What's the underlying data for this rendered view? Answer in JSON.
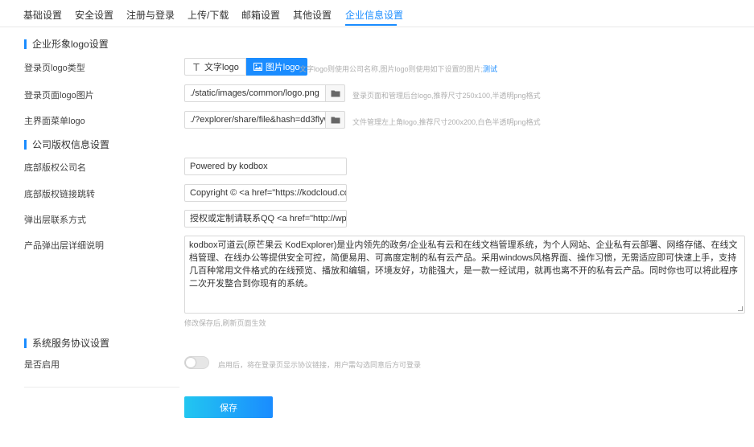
{
  "tabs": [
    {
      "label": "基础设置"
    },
    {
      "label": "安全设置"
    },
    {
      "label": "注册与登录"
    },
    {
      "label": "上传/下载"
    },
    {
      "label": "邮箱设置"
    },
    {
      "label": "其他设置"
    },
    {
      "label": "企业信息设置",
      "active": true
    }
  ],
  "sections": {
    "logo": {
      "title": "企业形象logo设置",
      "login_logo_type": {
        "label": "登录页logo类型",
        "options": [
          "文字logo",
          "图片logo"
        ],
        "selected": "图片logo",
        "hint": "文字logo则使用公司名称,图片logo则使用如下设置的图片;",
        "hint_link": "测试"
      },
      "login_logo_image": {
        "label": "登录页面logo图片",
        "value": "./static/images/common/logo.png",
        "hint": "登录页面和管理后台logo,推荐尺寸250x100,半透明png格式"
      },
      "menu_logo": {
        "label": "主界面菜单logo",
        "value": "./?explorer/share/file&hash=dd3flywDx",
        "hint": "文件管理左上角logo,推荐尺寸200x200,白色半透明png格式"
      }
    },
    "copyright": {
      "title": "公司版权信息设置",
      "company_name": {
        "label": "底部版权公司名",
        "value": "Powered by kodbox"
      },
      "copyright_link": {
        "label": "底部版权链接跳转",
        "value": "Copyright © <a href=\"https://kodcloud.com/\" t"
      },
      "contact": {
        "label": "弹出层联系方式",
        "value": "授权或定制请联系QQ <a href=\"http://wpa.qq."
      },
      "detail": {
        "label": "产品弹出层详细说明",
        "value": "kodbox可道云(原芒果云 KodExplorer)是业内领先的政务/企业私有云和在线文档管理系统，为个人网站、企业私有云部署、网络存储、在线文档管理、在线办公等提供安全可控，简便易用、可高度定制的私有云产品。采用windows风格界面、操作习惯，无需适应即可快速上手，支持几百种常用文件格式的在线预览、播放和编辑，环境友好，功能强大，是一款一经试用，就再也离不开的私有云产品。同时你也可以将此程序二次开发整合到你现有的系统。",
        "hint": "修改保存后,刷新页面生效"
      }
    },
    "agreement": {
      "title": "系统服务协议设置",
      "enable": {
        "label": "是否启用",
        "enabled": false,
        "hint": "启用后，将在登录页显示协议链接，用户需勾选同意后方可登录"
      }
    }
  },
  "actions": {
    "save_label": "保存"
  },
  "colors": {
    "accent": "#1a8cff",
    "accent_gradient_start": "#22c6f0"
  },
  "icons": {
    "text_logo": "text-t-icon",
    "image_logo": "image-icon",
    "folder": "folder-icon"
  }
}
